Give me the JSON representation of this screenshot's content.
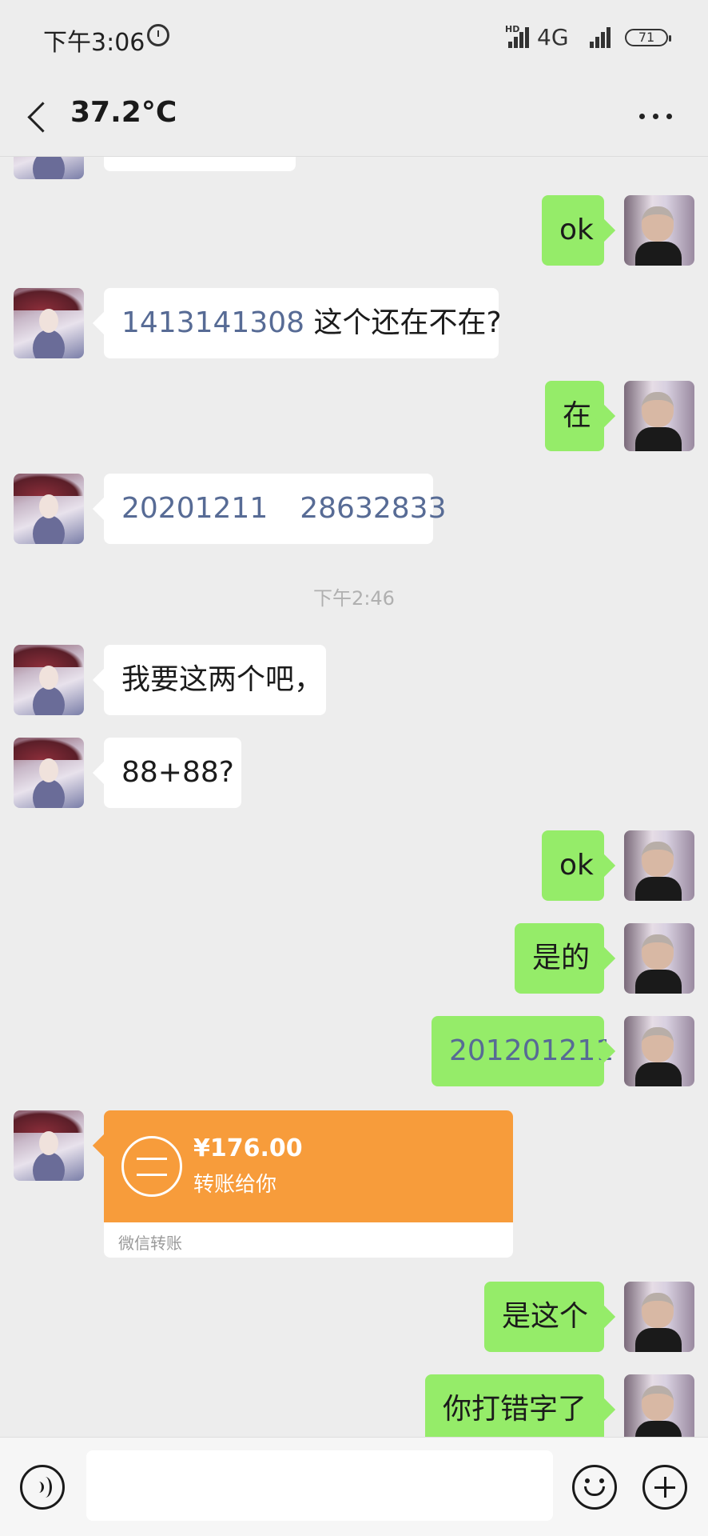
{
  "status_bar": {
    "time": "下午3:06",
    "hd": "HD",
    "network": "4G",
    "battery": "71"
  },
  "header": {
    "title": "37.2°C"
  },
  "messages": {
    "m1": {
      "text": "ok"
    },
    "m2": {
      "number": "1413141308",
      "text": "这个还在不在?"
    },
    "m3": {
      "text": "在"
    },
    "m4": {
      "part1": "20201211",
      "part2": "28632833"
    },
    "timestamp": "下午2:46",
    "m5": {
      "text": "我要这两个吧，"
    },
    "m6": {
      "text": "88+88?"
    },
    "m7": {
      "text": "ok"
    },
    "m8": {
      "text": "是的"
    },
    "m9": {
      "text": "201201211"
    },
    "transfer": {
      "amount": "¥176.00",
      "description": "转账给你",
      "footer": "微信转账",
      "color": "#f79c3b"
    },
    "m10": {
      "text": "是这个"
    },
    "m11": {
      "text": "你打错字了"
    }
  },
  "input": {
    "placeholder": ""
  },
  "colors": {
    "outgoing_bubble": "#95ec69",
    "incoming_bubble": "#ffffff",
    "link": "#576b95",
    "background": "#ededed"
  }
}
